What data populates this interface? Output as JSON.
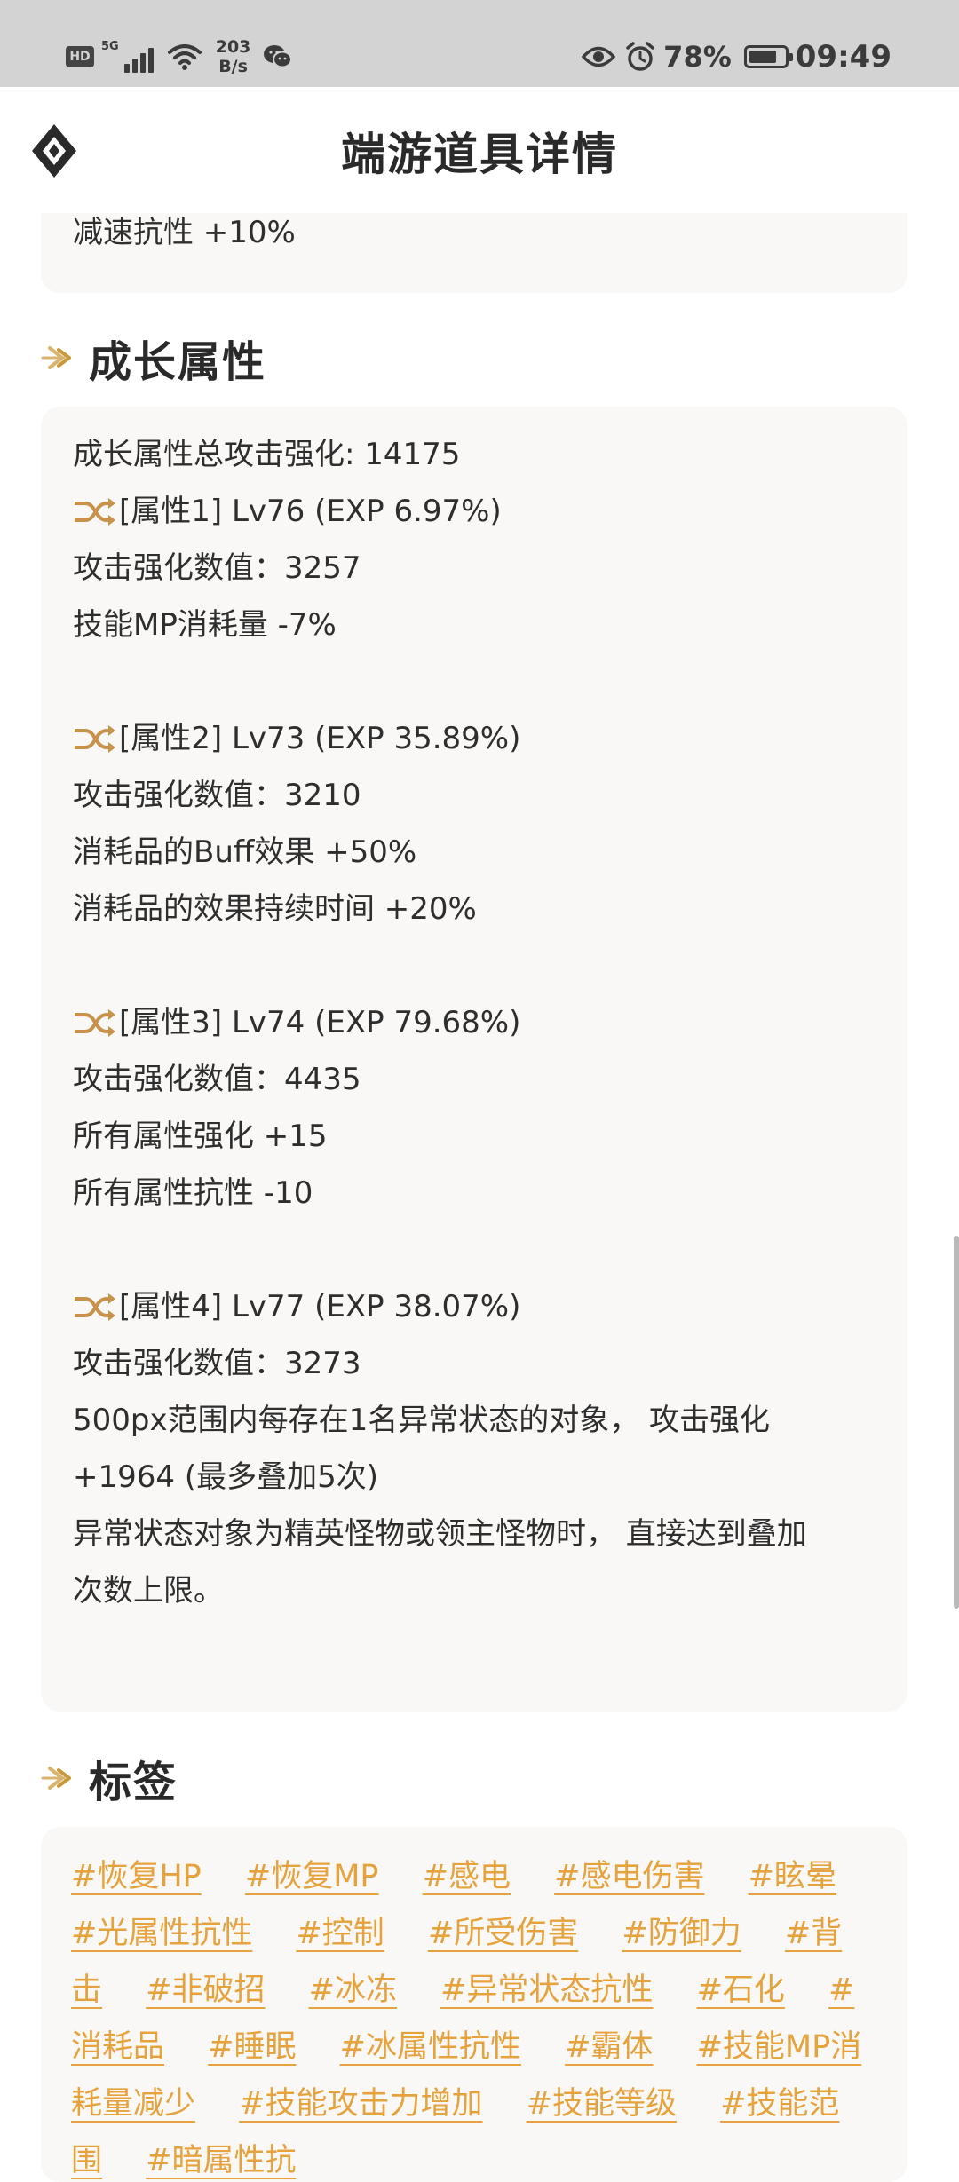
{
  "status_bar": {
    "hd": "HD",
    "network": "5G",
    "speed_value": "203",
    "speed_unit": "B/s",
    "battery_percent": "78%",
    "battery_level": 0.78,
    "time": "09:49"
  },
  "header": {
    "title": "端游道具详情"
  },
  "prev_card": {
    "last_line": "减速抗性 +10%"
  },
  "growth_section": {
    "title": "成长属性",
    "total": "成长属性总攻击强化: 14175",
    "attributes": [
      {
        "header": "[属性1] Lv76 (EXP 6.97%)",
        "lines": [
          "攻击强化数值：3257",
          "技能MP消耗量 -7%"
        ]
      },
      {
        "header": "[属性2] Lv73 (EXP 35.89%)",
        "lines": [
          "攻击强化数值：3210",
          "消耗品的Buff效果 +50%",
          "消耗品的效果持续时间 +20%"
        ]
      },
      {
        "header": "[属性3] Lv74 (EXP 79.68%)",
        "lines": [
          "攻击强化数值：4435",
          "所有属性强化 +15",
          "所有属性抗性 -10"
        ]
      },
      {
        "header": "[属性4] Lv77 (EXP 38.07%)",
        "lines": [
          "攻击强化数值：3273",
          "500px范围内每存在1名异常状态的对象， 攻击强化",
          "+1964 (最多叠加5次)",
          "异常状态对象为精英怪物或领主怪物时， 直接达到叠加",
          "次数上限。"
        ]
      }
    ]
  },
  "tags_section": {
    "title": "标签",
    "tags": [
      "#恢复HP",
      "#恢复MP",
      "#感电",
      "#感电伤害",
      "#眩晕",
      "#光属性抗性",
      "#控制",
      "#所受伤害",
      "#防御力",
      "#背击",
      "#非破招",
      "#冰冻",
      "#异常状态抗性",
      "#石化",
      "#消耗品",
      "#睡眠",
      "#冰属性抗性",
      "#霸体",
      "#技能MP消耗量减少",
      "#技能攻击力增加",
      "#技能等级",
      "#技能范围",
      "#暗属性抗"
    ]
  },
  "colors": {
    "accent": "#e6a23c",
    "card_bg": "#f9f8f6",
    "status_bar_bg": "#d3d3d3",
    "text": "#2e2e2e"
  }
}
